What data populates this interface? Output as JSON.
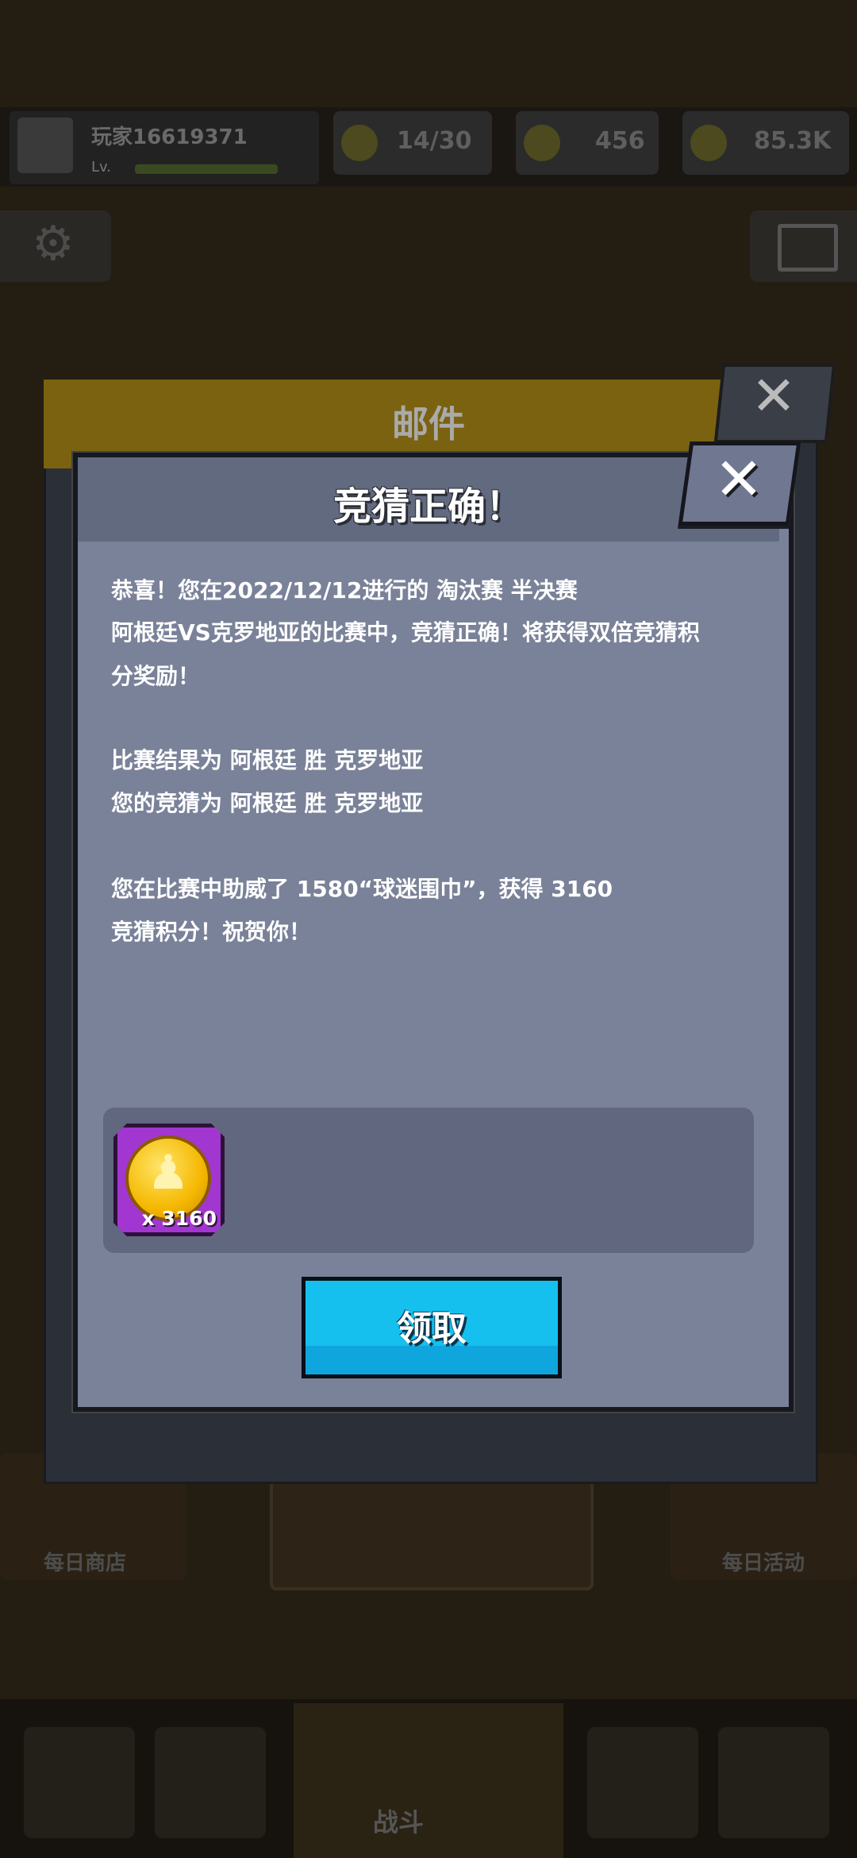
{
  "background": {
    "player_name": "玩家16619371",
    "player_level": "Lv.",
    "resources": [
      {
        "value": "14/30",
        "icon": "energy-icon"
      },
      {
        "value": "456",
        "icon": "gem-icon"
      },
      {
        "value": "85.3K",
        "icon": "coin-icon"
      }
    ],
    "stage_banner": "",
    "bottom_left_label": "每日商店",
    "bottom_center_title": "",
    "bottom_center_sub": "",
    "bottom_right_label": "每日活动",
    "nav_center_label": "战斗"
  },
  "mail_dialog": {
    "title": "邮件",
    "close_icon": "close-icon"
  },
  "result_popup": {
    "title": "竞猜正确！",
    "message_lines": [
      "恭喜！您在2022/12/12进行的 淘汰赛 半决赛",
      "阿根廷VS克罗地亚的比赛中，竞猜正确！将获得双倍竞猜积",
      "分奖励！",
      "",
      "比赛结果为 阿根廷 胜 克罗地亚",
      "您的竞猜为 阿根廷 胜 克罗地亚",
      "",
      "您在比赛中助威了 1580“球迷围巾”，获得 3160",
      "竞猜积分！祝贺你！"
    ],
    "reward": {
      "icon": "trophy-coin-icon",
      "quantity": "x 3160"
    },
    "claim_button": "领取",
    "close_glyph": "✕"
  },
  "colors": {
    "popup_body": "#7a8299",
    "popup_header": "#626a80",
    "reward_frame": "#a236d0",
    "claim_button": "#15c0ee"
  }
}
